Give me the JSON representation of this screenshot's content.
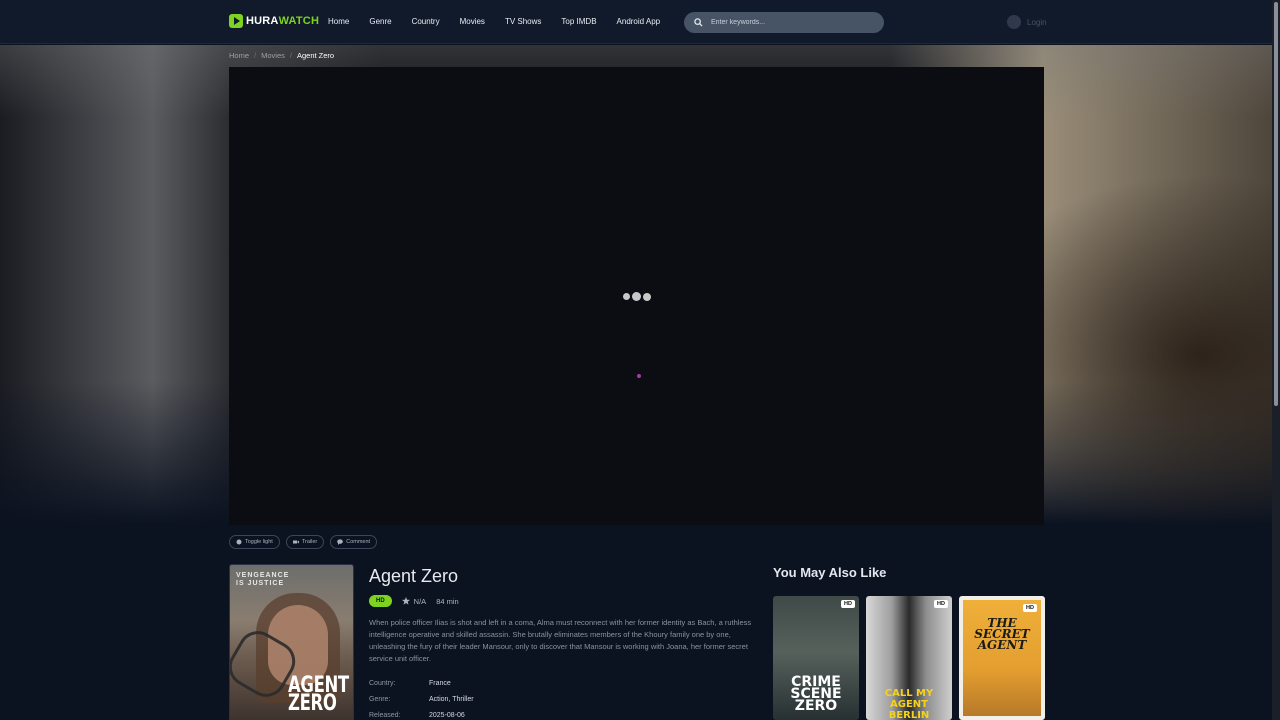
{
  "header": {
    "logo_text": "HURA",
    "logo_accent": "WATCH",
    "nav": [
      "Home",
      "Genre",
      "Country",
      "Movies",
      "TV Shows",
      "Top IMDB",
      "Android App"
    ],
    "search_placeholder": "Enter keywords...",
    "login_label": "Login"
  },
  "breadcrumb": {
    "items": [
      "Home",
      "Movies"
    ],
    "current": "Agent Zero",
    "separator": "/"
  },
  "actions": [
    "Toggle light",
    "Trailer",
    "Comment"
  ],
  "movie": {
    "poster_tagline": "VENGEANCE\nIS JUSTICE",
    "poster_title": "AGENT\nZERO",
    "title": "Agent Zero",
    "quality": "HD",
    "rating": "N/A",
    "duration": "84 min",
    "description": "When police officer Ilias is shot and left in a coma, Alma must reconnect with her former identity as Bach, a ruthless intelligence operative and skilled assassin. She brutally eliminates members of the Khoury family one by one, unleashing the fury of their leader Mansour, only to discover that Mansour is working with Joana, her former secret service unit officer.",
    "details": [
      {
        "label": "Country:",
        "value": "France"
      },
      {
        "label": "Genre:",
        "value": "Action, Thriller"
      },
      {
        "label": "Released:",
        "value": "2025-08-06"
      }
    ]
  },
  "related": {
    "heading": "You May Also Like",
    "items": [
      {
        "title": "CRIME\nSCENE\nZERO",
        "badge": "HD"
      },
      {
        "title": "CALL MY AGENT\nBERLIN",
        "badge": "HD"
      },
      {
        "title": "THE\nSECRET\nAGENT",
        "badge": "HD"
      }
    ]
  },
  "colors": {
    "accent": "#7ed321",
    "background": "#0b1220",
    "header": "#111a2b",
    "loader_dot": "#a43aa8"
  },
  "icons": [
    "search-icon",
    "user-avatar-icon",
    "bulb-icon",
    "video-icon",
    "comment-icon",
    "star-icon",
    "loading-dots-icon"
  ]
}
